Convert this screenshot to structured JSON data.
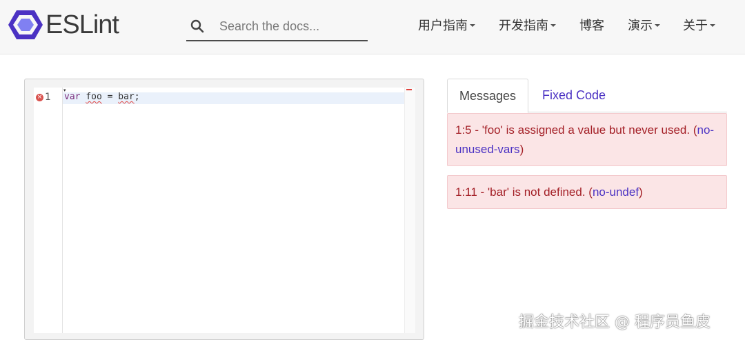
{
  "header": {
    "logo_text": "ESLint",
    "search_placeholder": "Search the docs...",
    "nav": [
      {
        "label": "用户指南",
        "has_dropdown": true
      },
      {
        "label": "开发指南",
        "has_dropdown": true
      },
      {
        "label": "博客",
        "has_dropdown": false
      },
      {
        "label": "演示",
        "has_dropdown": true
      },
      {
        "label": "关于",
        "has_dropdown": true
      }
    ]
  },
  "editor": {
    "line_number": "1",
    "code": {
      "kw": "var",
      "ident": "foo",
      "op": " = ",
      "ref": "bar",
      "end": ";"
    }
  },
  "tabs": {
    "messages": "Messages",
    "fixed_code": "Fixed Code"
  },
  "messages": [
    {
      "text": "1:5 - 'foo' is assigned a value but never used. (",
      "rule": "no-unused-vars",
      "close": ")"
    },
    {
      "text": "1:11 - 'bar' is not defined. (",
      "rule": "no-undef",
      "close": ")"
    }
  ],
  "watermark": "掘金技术社区 @ 程序员鱼皮",
  "colors": {
    "brand": "#4b32c3",
    "error_bg": "#fbe5e6",
    "error_text": "#a42027"
  }
}
